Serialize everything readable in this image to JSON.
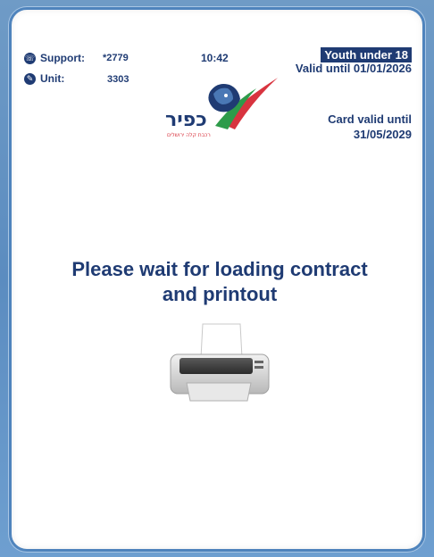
{
  "header": {
    "support_label": "Support:",
    "support_value": "*2779",
    "unit_label": "Unit:",
    "unit_value": "3303",
    "time": "10:42",
    "profile_badge": "Youth under 18",
    "profile_valid": "Valid until 01/01/2026",
    "card_valid_label": "Card valid until",
    "card_valid_date": "31/05/2029"
  },
  "logo": {
    "text": "כפיר",
    "subtext": "רכבת קלה ירושלים",
    "colors": {
      "brand_blue": "#1f3b73",
      "red": "#d8343f",
      "green": "#2e9b4a"
    }
  },
  "main": {
    "message_line1": "Please wait for loading contract",
    "message_line2": "and printout"
  },
  "icons": {
    "support": "phone-icon",
    "unit": "wrench-icon",
    "printer": "printer-icon"
  },
  "colors": {
    "text": "#1f3b73",
    "background": "#ffffff",
    "frame": "#4f84bd"
  }
}
